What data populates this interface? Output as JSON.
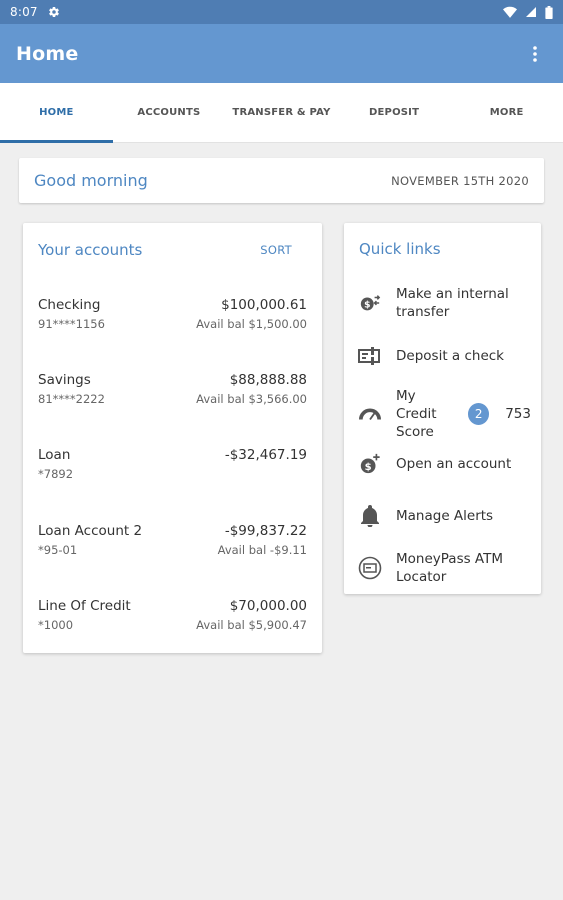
{
  "status_bar": {
    "time": "8:07"
  },
  "app_bar": {
    "title": "Home"
  },
  "tabs": [
    {
      "label": "HOME",
      "active": true
    },
    {
      "label": "ACCOUNTS"
    },
    {
      "label": "TRANSFER & PAY"
    },
    {
      "label": "DEPOSIT"
    },
    {
      "label": "MORE"
    }
  ],
  "greeting": {
    "text": "Good morning",
    "date": "NOVEMBER 15TH 2020"
  },
  "accounts": {
    "title": "Your accounts",
    "sort_label": "SORT",
    "items": [
      {
        "name": "Checking",
        "number": "91****1156",
        "balance": "$100,000.61",
        "available": "Avail bal $1,500.00"
      },
      {
        "name": "Savings",
        "number": "81****2222",
        "balance": "$88,888.88",
        "available": "Avail bal $3,566.00"
      },
      {
        "name": "Loan",
        "number": "*7892",
        "balance": "-$32,467.19",
        "available": ""
      },
      {
        "name": "Loan Account 2",
        "number": "*95-01",
        "balance": "-$99,837.22",
        "available": "Avail bal -$9.11"
      },
      {
        "name": "Line Of Credit",
        "number": "*1000",
        "balance": "$70,000.00",
        "available": "Avail bal $5,900.47"
      }
    ]
  },
  "quick_links": {
    "title": "Quick links",
    "items": [
      {
        "label": "Make an internal transfer",
        "icon": "transfer-icon"
      },
      {
        "label": "Deposit a check",
        "icon": "check-icon"
      },
      {
        "label": "My Credit Score",
        "icon": "gauge-icon",
        "badge": "2",
        "score": "753"
      },
      {
        "label": "Open an account",
        "icon": "dollar-plus-icon"
      },
      {
        "label": "Manage Alerts",
        "icon": "bell-icon"
      },
      {
        "label": "MoneyPass ATM Locator",
        "icon": "atm-icon"
      }
    ]
  },
  "colors": {
    "status_bar": "#4f7db3",
    "app_bar": "#6497d0",
    "accent": "#4e87c2",
    "tab_active": "#2f6ea8",
    "background": "#efefef"
  }
}
